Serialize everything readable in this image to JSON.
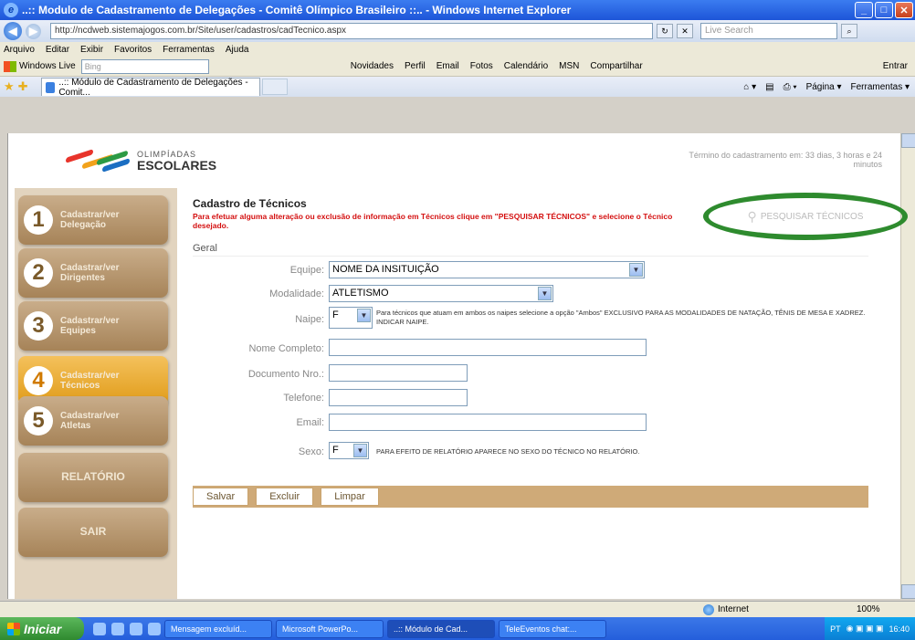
{
  "window": {
    "title": "..:: Modulo de Cadastramento de Delegações - Comitê Olímpico Brasileiro ::.. - Windows Internet Explorer",
    "min": "_",
    "max": "□",
    "close": "✕"
  },
  "address": {
    "url": "http://ncdweb.sistemajogos.com.br/Site/user/cadastros/cadTecnico.aspx",
    "live_search_placeholder": "Live Search"
  },
  "menu": [
    "Arquivo",
    "Editar",
    "Exibir",
    "Favoritos",
    "Ferramentas",
    "Ajuda"
  ],
  "links": {
    "windows_live": "Windows Live",
    "bing": "Bing",
    "items": [
      "Novidades",
      "Perfil",
      "Email",
      "Fotos",
      "Calendário",
      "MSN",
      "Compartilhar"
    ],
    "entrar": "Entrar"
  },
  "tab": {
    "title": "..:: Módulo de Cadastramento de Delegações - Comit...",
    "tools": [
      "Página ▾",
      "Ferramentas ▾"
    ]
  },
  "header": {
    "logo_small": "OLIMPÍADAS",
    "logo_big": "ESCOLARES",
    "time_left": "Término do cadastramento em: 33 dias, 3 horas e 24 minutos"
  },
  "sidebar": {
    "items": [
      {
        "num": "1",
        "line1": "Cadastrar/ver",
        "line2": "Delegação"
      },
      {
        "num": "2",
        "line1": "Cadastrar/ver",
        "line2": "Dirigentes"
      },
      {
        "num": "3",
        "line1": "Cadastrar/ver",
        "line2": "Equipes"
      },
      {
        "num": "4",
        "line1": "Cadastrar/ver",
        "line2": "Técnicos"
      },
      {
        "num": "5",
        "line1": "Cadastrar/ver",
        "line2": "Atletas"
      }
    ],
    "relatorio": "RELATÓRIO",
    "sair": "SAIR"
  },
  "form": {
    "title": "Cadastro de Técnicos",
    "warning": "Para efetuar alguma alteração ou exclusão de informação em Técnicos clique em \"PESQUISAR TÉCNICOS\" e selecione o Técnico desejado.",
    "pesquisar": "PESQUISAR TÉCNICOS",
    "section": "Geral",
    "labels": {
      "equipe": "Equipe:",
      "modalidade": "Modalidade:",
      "naipe": "Naipe:",
      "nome": "Nome Completo:",
      "documento": "Documento Nro.:",
      "telefone": "Telefone:",
      "email": "Email:",
      "sexo": "Sexo:"
    },
    "values": {
      "equipe": "NOME DA INSITUIÇÃO",
      "modalidade": "ATLETISMO",
      "naipe": "F",
      "nome": "",
      "documento": "",
      "telefone": "",
      "email": "",
      "sexo": "F"
    },
    "naipe_note": "Para técnicos que atuam em ambos os naipes selecione a opção \"Ambos\" EXCLUSIVO PARA AS MODALIDADES DE NATAÇÃO, TÊNIS DE MESA E XADREZ. INDICAR NAIPE.",
    "sexo_note": "PARA EFEITO DE RELATÓRIO APARECE NO SEXO DO TÉCNICO NO RELATÓRIO.",
    "buttons": {
      "salvar": "Salvar",
      "excluir": "Excluir",
      "limpar": "Limpar"
    }
  },
  "status": {
    "zone": "Internet",
    "zoom": "100%"
  },
  "taskbar": {
    "start": "Iniciar",
    "tasks": [
      "Mensagem excluíd...",
      "Microsoft PowerPo...",
      "..:: Módulo de Cad...",
      "TeleEventos chat:..."
    ],
    "tray_lang": "PT",
    "clock": "16:40"
  },
  "colors": {
    "accent_green": "#2e8b2e",
    "warning_red": "#d41010",
    "active_nav": "#e09b18"
  }
}
